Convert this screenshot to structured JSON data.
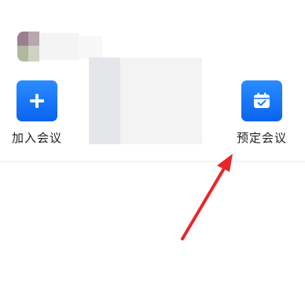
{
  "actions": [
    {
      "label": "加入会议",
      "icon": "plus-icon"
    },
    {
      "label": "预定会议",
      "icon": "calendar-check-icon"
    }
  ],
  "colors": {
    "accent": "#1677ff",
    "arrow": "#e8262a",
    "text": "#222222"
  }
}
